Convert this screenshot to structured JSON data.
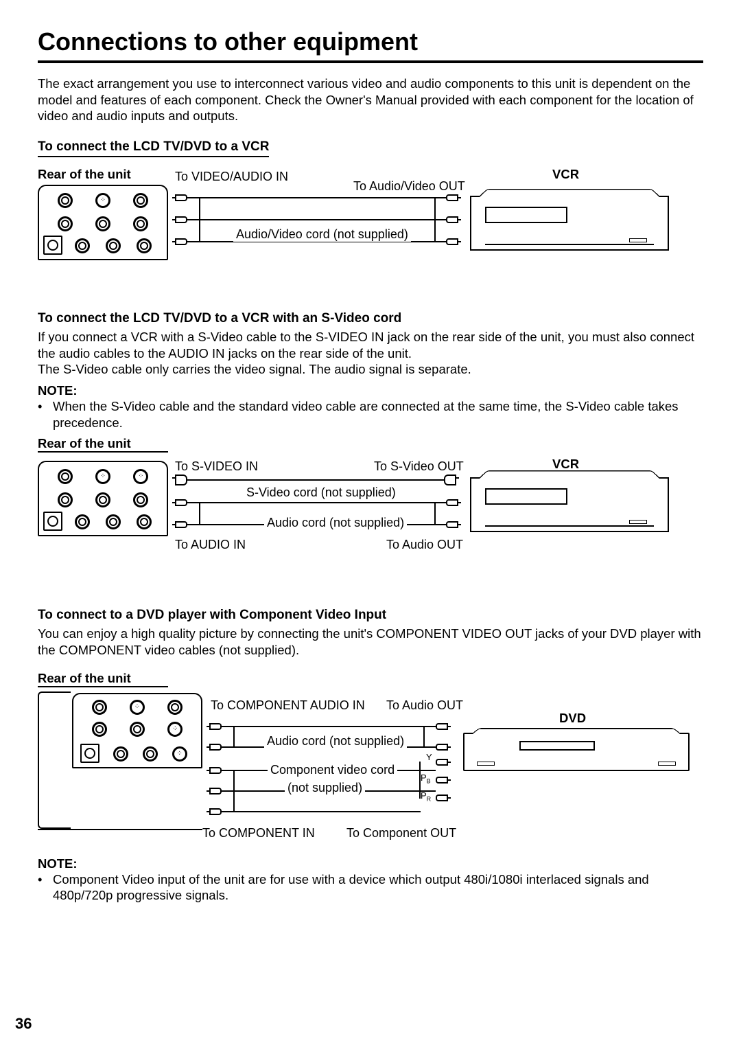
{
  "page_title": "Connections to other equipment",
  "intro": "The exact arrangement you use to interconnect various video and audio components to this unit is dependent on the model and features of each component. Check the Owner's Manual provided with each component for the location of video and audio inputs and outputs.",
  "section1": {
    "heading": "To connect the LCD TV/DVD to a VCR",
    "rear_label": "Rear of the unit",
    "to_in": "To VIDEO/AUDIO IN",
    "to_out": "To Audio/Video OUT",
    "cord": "Audio/Video cord (not supplied)",
    "device_label": "VCR"
  },
  "section2": {
    "heading": "To connect the LCD TV/DVD to a VCR with an S-Video cord",
    "body1": "If you connect a VCR with a S-Video cable to the S-VIDEO IN jack on the rear side of the unit, you must also connect the audio cables to the AUDIO IN jacks on the rear side of the unit.",
    "body2": "The S-Video cable only carries the video signal. The audio signal is separate.",
    "note_label": "NOTE:",
    "note_item": "When the S-Video cable and the standard video cable are connected at the same time, the S-Video cable takes precedence.",
    "rear_label": "Rear of the unit",
    "to_svideo_in": "To S-VIDEO IN",
    "to_svideo_out": "To S-Video OUT",
    "svideo_cord": "S-Video cord (not supplied)",
    "to_audio_in": "To AUDIO IN",
    "to_audio_out": "To Audio OUT",
    "audio_cord": "Audio cord (not supplied)",
    "device_label": "VCR"
  },
  "section3": {
    "heading": "To connect to a DVD player with Component Video Input",
    "body": "You can enjoy a high quality picture by connecting the unit's COMPONENT VIDEO OUT jacks of your DVD player with the COMPONENT video cables (not supplied).",
    "rear_label": "Rear of the unit",
    "to_comp_audio_in": "To COMPONENT AUDIO IN",
    "to_audio_out": "To Audio OUT",
    "audio_cord": "Audio cord (not supplied)",
    "comp_cord1": "Component video cord",
    "comp_cord2": "(not supplied)",
    "to_comp_in": "To COMPONENT IN",
    "to_comp_out": "To Component OUT",
    "device_label": "DVD",
    "y": "Y",
    "pb": "P",
    "pb_sub": "B",
    "pr": "P",
    "pr_sub": "R",
    "note_label": "NOTE:",
    "note_item": "Component Video input of the unit are for use with a device which output 480i/1080i interlaced signals and 480p/720p progressive signals."
  },
  "page_number": "36"
}
